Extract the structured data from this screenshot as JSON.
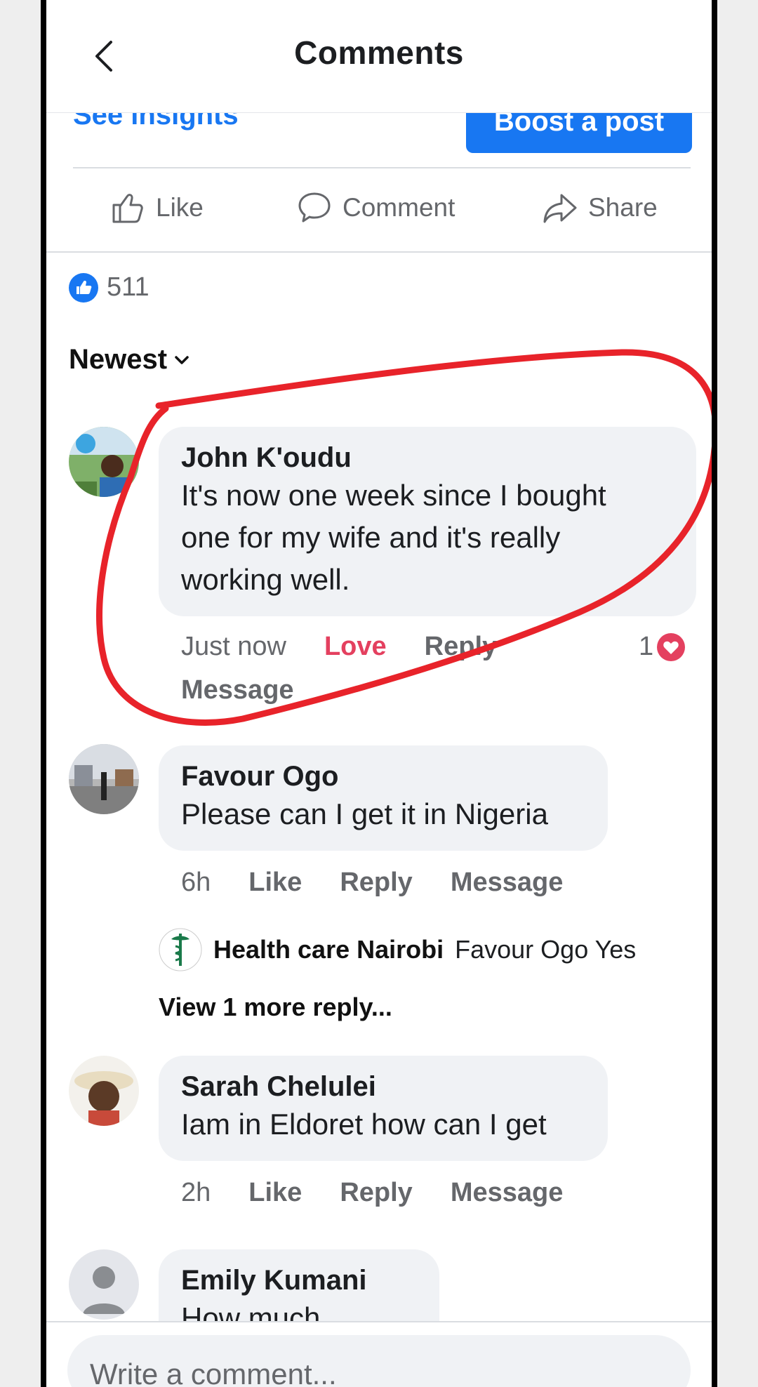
{
  "header": {
    "title": "Comments",
    "back_icon": "chevron-left-icon"
  },
  "post_bar": {
    "insights_label": "See insights",
    "boost_label": "Boost a post"
  },
  "actions": {
    "like": "Like",
    "comment": "Comment",
    "share": "Share"
  },
  "reactions": {
    "count": "511"
  },
  "sort": {
    "label": "Newest"
  },
  "comments": [
    {
      "name": "John K'oudu",
      "text_lines": [
        "It's now one week since I bought",
        "one for my wife and it's really",
        "working well."
      ],
      "time": "Just now",
      "reaction_label": "Love",
      "reply_label": "Reply",
      "message_label": "Message",
      "reaction_count": "1"
    },
    {
      "name": "Favour Ogo",
      "text_lines": [
        "Please can I get it in Nigeria"
      ],
      "time": "6h",
      "like_label": "Like",
      "reply_label": "Reply",
      "message_label": "Message"
    },
    {
      "name": "Sarah Chelulei",
      "text_lines": [
        "Iam in Eldoret how can I get"
      ],
      "time": "2h",
      "like_label": "Like",
      "reply_label": "Reply",
      "message_label": "Message"
    },
    {
      "name": "Emily Kumani",
      "text_lines": [
        "How much"
      ]
    }
  ],
  "reply": {
    "name": "Health care Nairobi",
    "text": "Favour Ogo Yes"
  },
  "view_more": "View 1 more reply...",
  "composer": {
    "placeholder": "Write a comment..."
  },
  "colors": {
    "accent": "#1877f2",
    "love": "#e4405f",
    "annotation": "#e8232a"
  }
}
